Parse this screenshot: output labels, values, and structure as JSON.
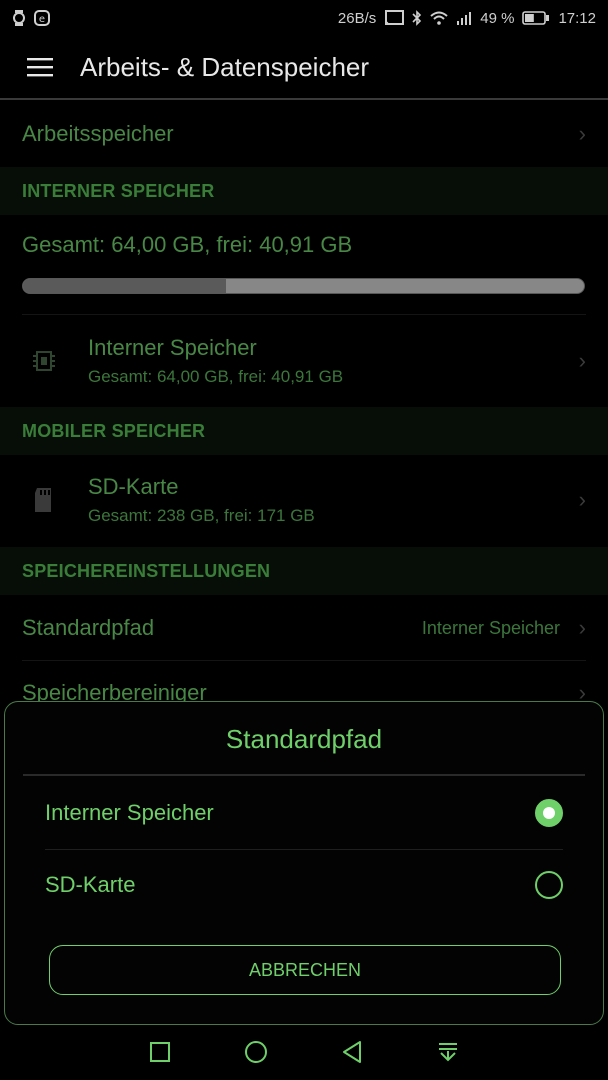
{
  "statusbar": {
    "speed": "26B/s",
    "battery_percent": "49 %",
    "time": "17:12",
    "battery_level": 0.49
  },
  "appbar": {
    "title": "Arbeits- & Datenspeicher"
  },
  "memory_row": {
    "label": "Arbeitsspeicher"
  },
  "internal_section": {
    "header": "INTERNER SPEICHER",
    "summary": "Gesamt: 64,00 GB, frei: 40,91 GB",
    "used_fraction": 0.361,
    "item": {
      "title": "Interner Speicher",
      "subtitle": "Gesamt: 64,00 GB, frei: 40,91 GB"
    }
  },
  "mobile_section": {
    "header": "MOBILER SPEICHER",
    "item": {
      "title": "SD-Karte",
      "subtitle": "Gesamt: 238 GB, frei: 171 GB"
    }
  },
  "settings_section": {
    "header": "SPEICHEREINSTELLUNGEN",
    "standardpfad_label": "Standardpfad",
    "standardpfad_value": "Interner Speicher",
    "cleaner_label": "Speicherbereiniger"
  },
  "dialog": {
    "title": "Standardpfad",
    "options": [
      {
        "label": "Interner Speicher",
        "selected": true
      },
      {
        "label": "SD-Karte",
        "selected": false
      }
    ],
    "cancel_label": "ABBRECHEN"
  },
  "colors": {
    "accent": "#6fd06a",
    "background": "#000000",
    "section_bg": "#0b160b"
  }
}
